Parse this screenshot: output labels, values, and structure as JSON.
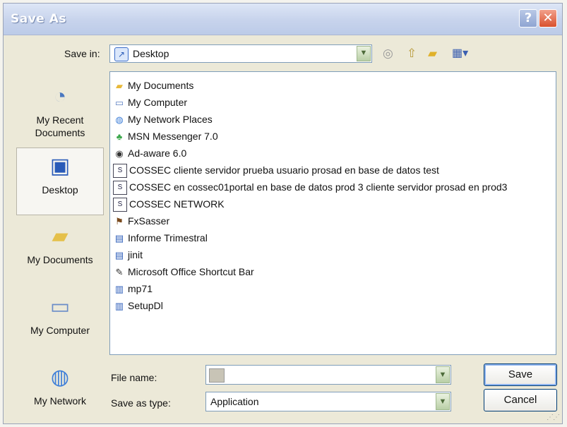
{
  "window": {
    "title": "Save As"
  },
  "title_buttons": {
    "help": "?",
    "close": "✕"
  },
  "toolbar": {
    "save_in_label": "Save in:",
    "save_in_value": "Desktop",
    "back_icon": "back-icon",
    "up_icon": "up-folder-icon",
    "new_folder_icon": "new-folder-icon",
    "views_icon": "views-menu-icon"
  },
  "places": [
    {
      "label": "My Recent\nDocuments",
      "icon": "recent-documents-icon"
    },
    {
      "label": "Desktop",
      "icon": "desktop-icon"
    },
    {
      "label": "My Documents",
      "icon": "my-documents-icon"
    },
    {
      "label": "My Computer",
      "icon": "my-computer-icon"
    },
    {
      "label": "My Network",
      "icon": "my-network-icon"
    }
  ],
  "files": [
    {
      "name": "My Documents",
      "icon": "folder-icon"
    },
    {
      "name": "My Computer",
      "icon": "computer-icon"
    },
    {
      "name": "My Network Places",
      "icon": "network-places-icon"
    },
    {
      "name": "MSN Messenger 7.0",
      "icon": "msn-icon"
    },
    {
      "name": "Ad-aware 6.0",
      "icon": "adaware-icon"
    },
    {
      "name": "COSSEC cliente servidor prueba usuario prosad en base de datos test",
      "icon": "shortcut-icon"
    },
    {
      "name": "COSSEC en cossec01portal en base de datos prod 3 cliente servidor prosad en prod3",
      "icon": "shortcut-icon"
    },
    {
      "name": "COSSEC NETWORK",
      "icon": "shortcut-icon"
    },
    {
      "name": "FxSasser",
      "icon": "fxsasser-icon"
    },
    {
      "name": "Informe Trimestral",
      "icon": "shortcut-icon"
    },
    {
      "name": "jinit",
      "icon": "shortcut-icon"
    },
    {
      "name": "Microsoft Office Shortcut Bar",
      "icon": "office-icon"
    },
    {
      "name": "mp71",
      "icon": "document-icon"
    },
    {
      "name": "SetupDl",
      "icon": "document-icon"
    }
  ],
  "form": {
    "file_name_label": "File name:",
    "file_name_value": "",
    "save_as_type_label": "Save as type:",
    "save_as_type_value": "Application"
  },
  "buttons": {
    "save": "Save",
    "cancel": "Cancel"
  },
  "colors": {
    "selection": "#316ac5",
    "title_gradient": "#c7d3ec",
    "close": "#d9512e"
  }
}
